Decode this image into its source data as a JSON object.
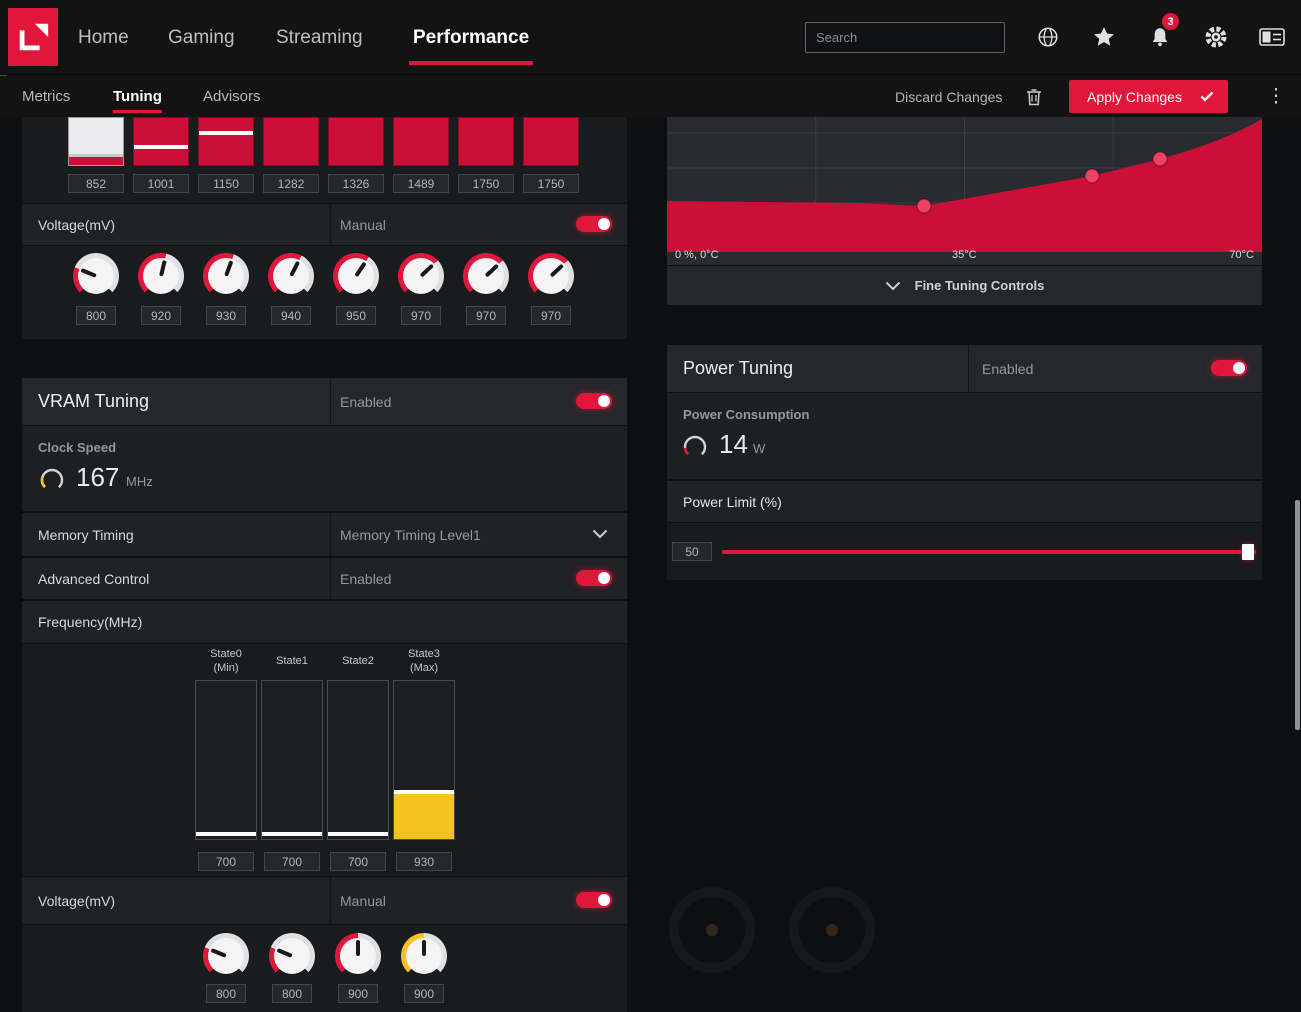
{
  "colors": {
    "accent": "#e0173a",
    "yellow": "#f6c222",
    "chart_red": "#cc0f36"
  },
  "topnav": {
    "items": [
      "Home",
      "Gaming",
      "Streaming",
      "Performance"
    ],
    "active_item": "Performance",
    "search_placeholder": "Search",
    "notification_badge": "3"
  },
  "subnav": {
    "items": [
      "Metrics",
      "Tuning",
      "Advisors"
    ],
    "active_item": "Tuning",
    "discard_label": "Discard Changes",
    "apply_label": "Apply Changes"
  },
  "gpu_tuning": {
    "frequency_values": [
      "852",
      "1001",
      "1150",
      "1282",
      "1326",
      "1489",
      "1750",
      "1750"
    ],
    "voltage_label": "Voltage(mV)",
    "voltage_mode": "Manual",
    "voltage_enabled": true,
    "voltage_values": [
      "800",
      "920",
      "930",
      "940",
      "950",
      "970",
      "970",
      "970"
    ]
  },
  "vram_tuning": {
    "title": "VRAM Tuning",
    "enabled_label": "Enabled",
    "enabled": true,
    "clock_speed_label": "Clock Speed",
    "clock_speed_value": "167",
    "clock_speed_unit": "MHz",
    "memory_timing_label": "Memory Timing",
    "memory_timing_value": "Memory Timing Level1",
    "advanced_control_label": "Advanced Control",
    "advanced_control_value": "Enabled",
    "frequency_label": "Frequency(MHz)",
    "state_headers": [
      [
        "State0",
        "(Min)"
      ],
      [
        "State1",
        ""
      ],
      [
        "State2",
        ""
      ],
      [
        "State3",
        "(Max)"
      ]
    ],
    "frequency_values": [
      "700",
      "700",
      "700",
      "930"
    ],
    "voltage_label": "Voltage(mV)",
    "voltage_mode": "Manual",
    "voltage_values": [
      "800",
      "800",
      "900",
      "900"
    ]
  },
  "fan_tuning": {
    "axis_labels": {
      "origin": "0 %, 0°C",
      "mid": "35°C",
      "max": "70°C"
    },
    "fine_tuning_label": "Fine Tuning Controls",
    "curve_points_est": [
      {
        "temp_c": 0,
        "speed_pct": 35
      },
      {
        "temp_c": 30,
        "speed_pct": 34
      },
      {
        "temp_c": 50,
        "speed_pct": 56
      },
      {
        "temp_c": 58,
        "speed_pct": 68
      },
      {
        "temp_c": 70,
        "speed_pct": 100
      }
    ]
  },
  "power_tuning": {
    "title": "Power Tuning",
    "enabled_label": "Enabled",
    "enabled": true,
    "consumption_label": "Power Consumption",
    "consumption_value": "14",
    "consumption_unit": "W",
    "limit_label": "Power Limit (%)",
    "limit_value": "50"
  }
}
